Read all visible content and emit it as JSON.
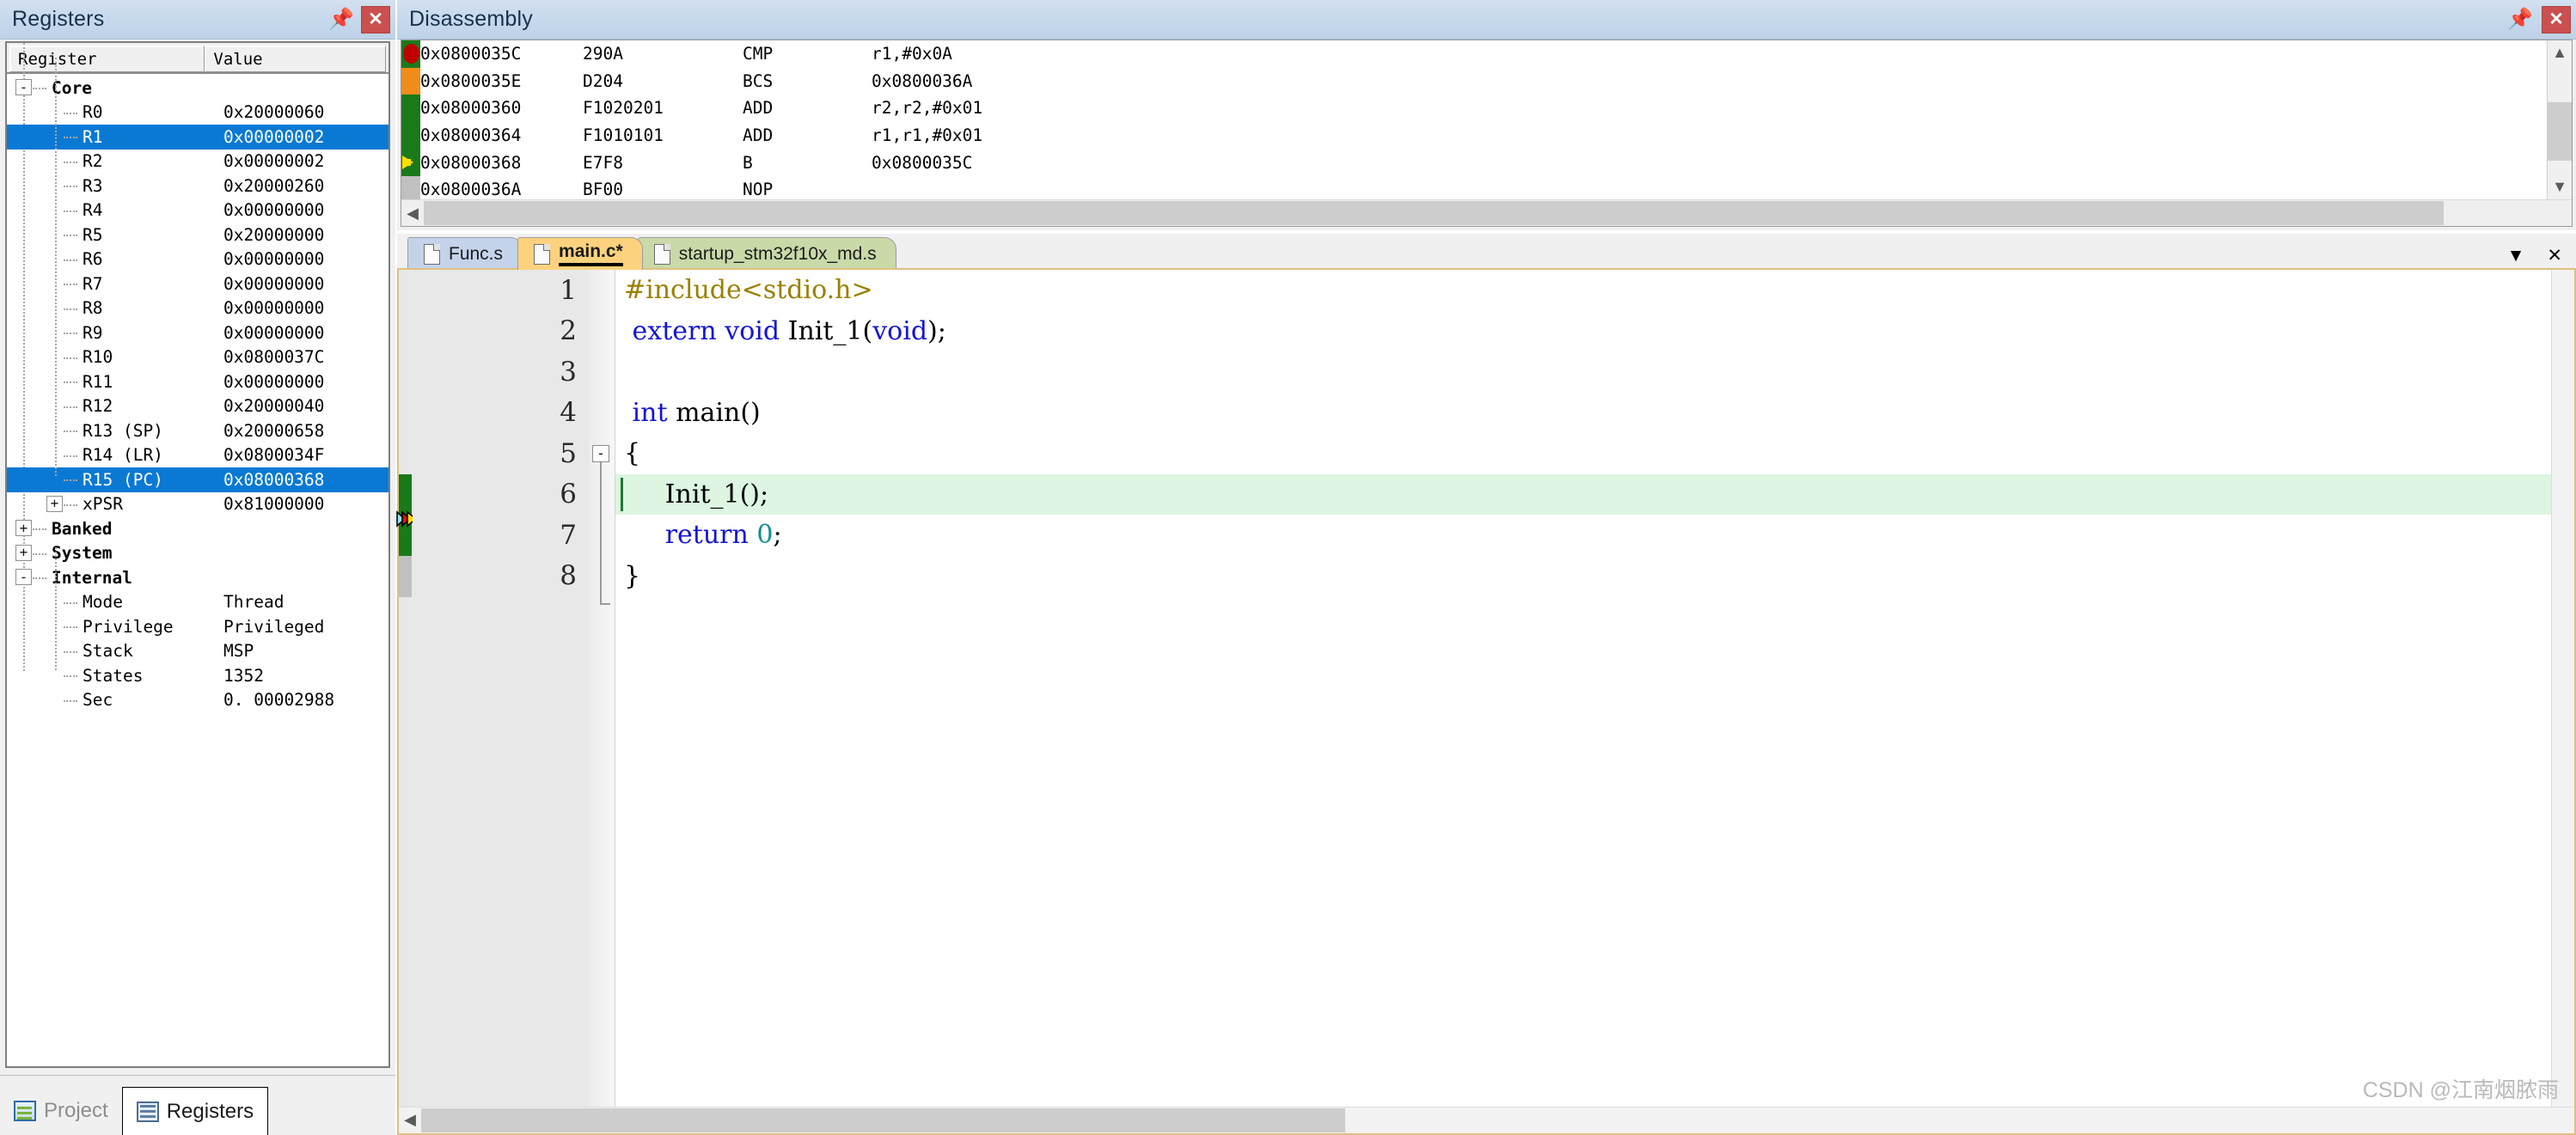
{
  "registers_panel": {
    "title": "Registers",
    "pin_icon": "pin-icon",
    "close_icon": "close-icon",
    "columns": [
      "Register",
      "Value"
    ],
    "rows": [
      {
        "name": "Core",
        "value": "",
        "depth": 0,
        "toggle": "-",
        "group": true,
        "selected": false
      },
      {
        "name": "R0",
        "value": "0x20000060",
        "depth": 1,
        "toggle": "",
        "group": false,
        "selected": false
      },
      {
        "name": "R1",
        "value": "0x00000002",
        "depth": 1,
        "toggle": "",
        "group": false,
        "selected": true
      },
      {
        "name": "R2",
        "value": "0x00000002",
        "depth": 1,
        "toggle": "",
        "group": false,
        "selected": false
      },
      {
        "name": "R3",
        "value": "0x20000260",
        "depth": 1,
        "toggle": "",
        "group": false,
        "selected": false
      },
      {
        "name": "R4",
        "value": "0x00000000",
        "depth": 1,
        "toggle": "",
        "group": false,
        "selected": false
      },
      {
        "name": "R5",
        "value": "0x20000000",
        "depth": 1,
        "toggle": "",
        "group": false,
        "selected": false
      },
      {
        "name": "R6",
        "value": "0x00000000",
        "depth": 1,
        "toggle": "",
        "group": false,
        "selected": false
      },
      {
        "name": "R7",
        "value": "0x00000000",
        "depth": 1,
        "toggle": "",
        "group": false,
        "selected": false
      },
      {
        "name": "R8",
        "value": "0x00000000",
        "depth": 1,
        "toggle": "",
        "group": false,
        "selected": false
      },
      {
        "name": "R9",
        "value": "0x00000000",
        "depth": 1,
        "toggle": "",
        "group": false,
        "selected": false
      },
      {
        "name": "R10",
        "value": "0x0800037C",
        "depth": 1,
        "toggle": "",
        "group": false,
        "selected": false
      },
      {
        "name": "R11",
        "value": "0x00000000",
        "depth": 1,
        "toggle": "",
        "group": false,
        "selected": false
      },
      {
        "name": "R12",
        "value": "0x20000040",
        "depth": 1,
        "toggle": "",
        "group": false,
        "selected": false
      },
      {
        "name": "R13 (SP)",
        "value": "0x20000658",
        "depth": 1,
        "toggle": "",
        "group": false,
        "selected": false
      },
      {
        "name": "R14 (LR)",
        "value": "0x0800034F",
        "depth": 1,
        "toggle": "",
        "group": false,
        "selected": false
      },
      {
        "name": "R15 (PC)",
        "value": "0x08000368",
        "depth": 1,
        "toggle": "",
        "group": false,
        "selected": true
      },
      {
        "name": "xPSR",
        "value": "0x81000000",
        "depth": 1,
        "toggle": "+",
        "group": false,
        "selected": false
      },
      {
        "name": "Banked",
        "value": "",
        "depth": 0,
        "toggle": "+",
        "group": true,
        "selected": false
      },
      {
        "name": "System",
        "value": "",
        "depth": 0,
        "toggle": "+",
        "group": true,
        "selected": false
      },
      {
        "name": "Internal",
        "value": "",
        "depth": 0,
        "toggle": "-",
        "group": true,
        "selected": false
      },
      {
        "name": "Mode",
        "value": "Thread",
        "depth": 1,
        "toggle": "",
        "group": false,
        "selected": false
      },
      {
        "name": "Privilege",
        "value": "Privileged",
        "depth": 1,
        "toggle": "",
        "group": false,
        "selected": false
      },
      {
        "name": "Stack",
        "value": "MSP",
        "depth": 1,
        "toggle": "",
        "group": false,
        "selected": false
      },
      {
        "name": "States",
        "value": "1352",
        "depth": 1,
        "toggle": "",
        "group": false,
        "selected": false
      },
      {
        "name": "Sec",
        "value": "0. 00002988",
        "depth": 1,
        "toggle": "",
        "group": false,
        "selected": false
      }
    ]
  },
  "bottom_tabs": [
    {
      "label": "Project",
      "icon": "project-icon",
      "active": false
    },
    {
      "label": "Registers",
      "icon": "registers-icon",
      "active": true
    }
  ],
  "disassembly": {
    "title": "Disassembly",
    "pin_icon": "pin-icon",
    "close_icon": "close-icon",
    "lines": [
      {
        "address": "0x0800035C",
        "encoding": "290A",
        "mnemonic": "CMP",
        "operands": "r1,#0x0A",
        "marker": "breakpoint",
        "marker_color": "#c00000",
        "gutter_color": "#1a7a1a"
      },
      {
        "address": "0x0800035E",
        "encoding": "D204",
        "mnemonic": "BCS",
        "operands": "0x0800036A",
        "marker": "",
        "marker_color": "",
        "gutter_color": "#f08c1a"
      },
      {
        "address": "0x08000360",
        "encoding": "F1020201",
        "mnemonic": "ADD",
        "operands": "r2,r2,#0x01",
        "marker": "",
        "marker_color": "",
        "gutter_color": "#1a7a1a"
      },
      {
        "address": "0x08000364",
        "encoding": "F1010101",
        "mnemonic": "ADD",
        "operands": "r1,r1,#0x01",
        "marker": "",
        "marker_color": "",
        "gutter_color": "#1a7a1a"
      },
      {
        "address": "0x08000368",
        "encoding": "E7F8",
        "mnemonic": "B",
        "operands": "0x0800035C",
        "marker": "pc-arrow",
        "marker_color": "#ffe000",
        "gutter_color": "#1a7a1a"
      },
      {
        "address": "0x0800036A",
        "encoding": "BF00",
        "mnemonic": "NOP",
        "operands": "",
        "marker": "",
        "marker_color": "",
        "gutter_color": "#c0c0c0"
      }
    ],
    "scroll_left_icon": "chevron-left-icon",
    "scroll_up_icon": "chevron-up-icon",
    "scroll_down_icon": "chevron-down-icon",
    "scroll_right_icon": "chevron-right-icon"
  },
  "editor": {
    "tabs": [
      {
        "label": "Func.s",
        "color": "blue",
        "active": false
      },
      {
        "label": "main.c*",
        "color": "orange",
        "active": true
      },
      {
        "label": "startup_stm32f10x_md.s",
        "color": "green",
        "active": false
      }
    ],
    "dropdown_icon": "chevron-down-icon",
    "close_icon": "close-icon",
    "code_lines": [
      {
        "num": "1",
        "highlight": false,
        "tokens": [
          {
            "t": "#include<stdio.h>",
            "c": "pp"
          }
        ]
      },
      {
        "num": "2",
        "highlight": false,
        "tokens": [
          {
            "t": " ",
            "c": "plain"
          },
          {
            "t": "extern",
            "c": "kw"
          },
          {
            "t": " ",
            "c": "plain"
          },
          {
            "t": "void",
            "c": "kw"
          },
          {
            "t": " Init_1(",
            "c": "plain"
          },
          {
            "t": "void",
            "c": "kw"
          },
          {
            "t": ");",
            "c": "plain"
          }
        ]
      },
      {
        "num": "3",
        "highlight": false,
        "tokens": [
          {
            "t": "",
            "c": "plain"
          }
        ]
      },
      {
        "num": "4",
        "highlight": false,
        "tokens": [
          {
            "t": " ",
            "c": "plain"
          },
          {
            "t": "int",
            "c": "kw"
          },
          {
            "t": " main()",
            "c": "plain"
          }
        ]
      },
      {
        "num": "5",
        "highlight": false,
        "tokens": [
          {
            "t": "{",
            "c": "plain"
          }
        ]
      },
      {
        "num": "6",
        "highlight": true,
        "tokens": [
          {
            "t": "     Init_1();",
            "c": "plain"
          }
        ]
      },
      {
        "num": "7",
        "highlight": false,
        "tokens": [
          {
            "t": "     ",
            "c": "plain"
          },
          {
            "t": "return",
            "c": "kw"
          },
          {
            "t": " ",
            "c": "plain"
          },
          {
            "t": "0",
            "c": "num"
          },
          {
            "t": ";",
            "c": "plain"
          }
        ]
      },
      {
        "num": "8",
        "highlight": false,
        "tokens": [
          {
            "t": "}",
            "c": "plain"
          }
        ]
      }
    ],
    "fold_marker": "-",
    "watermark": "CSDN @江南烟脓雨"
  },
  "colors": {
    "selection_blue": "#0a79d4",
    "breakpoint_red": "#c00000",
    "pc_yellow": "#ffe000",
    "exec_green": "#1a7a1a",
    "partial_orange": "#f08c1a",
    "highlight_line": "#ddf5e1",
    "titlebar_blue": "#c8d9ec",
    "tab_orange": "#fcd27e",
    "tab_blue": "#c4d3ea",
    "tab_green": "#c9d9a8"
  }
}
